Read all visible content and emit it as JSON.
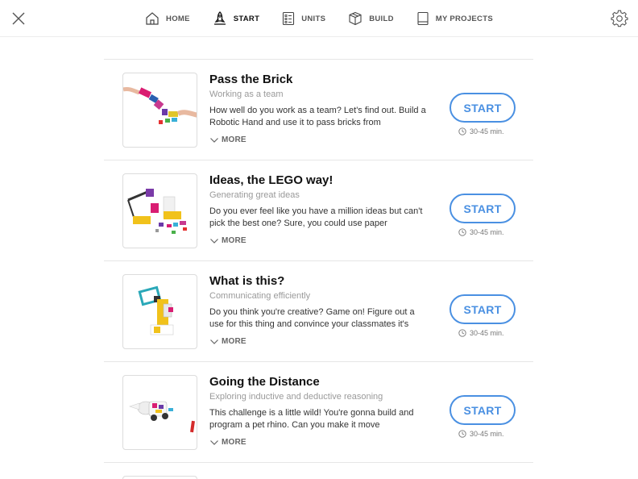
{
  "nav": {
    "items": [
      {
        "label": "HOME",
        "icon": "home-icon",
        "active": false
      },
      {
        "label": "START",
        "icon": "rocket-icon",
        "active": true
      },
      {
        "label": "UNITS",
        "icon": "checklist-icon",
        "active": false
      },
      {
        "label": "BUILD",
        "icon": "box-icon",
        "active": false
      },
      {
        "label": "MY PROJECTS",
        "icon": "book-icon",
        "active": false
      }
    ],
    "close_icon": "close-icon",
    "settings_icon": "gear-icon"
  },
  "lessons": [
    {
      "title": "Pass the Brick",
      "subtitle": "Working as a team",
      "description": "How well do you work as a team? Let's find out. Build a Robotic Hand and use it to pass bricks from",
      "more_label": "MORE",
      "start_label": "START",
      "duration": "30-45 min."
    },
    {
      "title": "Ideas, the LEGO way!",
      "subtitle": "Generating great ideas",
      "description": "Do you ever feel like you have a million ideas but can't pick the best one? Sure, you could use paper",
      "more_label": "MORE",
      "start_label": "START",
      "duration": "30-45 min."
    },
    {
      "title": "What is this?",
      "subtitle": "Communicating efficiently",
      "description": "Do you think you're creative? Game on! Figure out a use for this thing and convince your classmates it's",
      "more_label": "MORE",
      "start_label": "START",
      "duration": "30-45 min."
    },
    {
      "title": "Going the Distance",
      "subtitle": "Exploring inductive and deductive reasoning",
      "description": "This challenge is a little wild! You're gonna build and program a pet rhino. Can you make it move",
      "more_label": "MORE",
      "start_label": "START",
      "duration": "30-45 min."
    }
  ],
  "colors": {
    "accent": "#4a90e2",
    "divider": "#e6e6e6",
    "subtitle": "#9a9a9a"
  }
}
